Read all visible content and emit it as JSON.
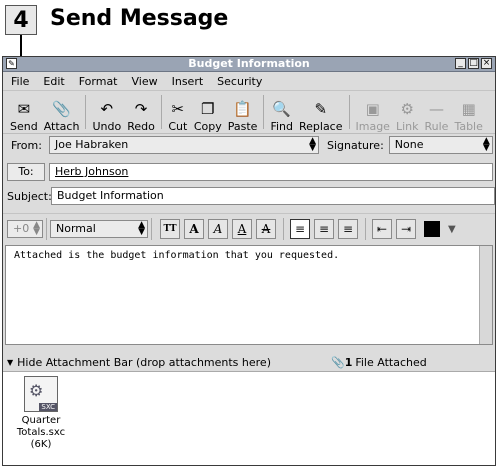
{
  "step": {
    "number": "4",
    "title": "Send Message"
  },
  "window": {
    "title": "Budget Information"
  },
  "menu": [
    {
      "label": "File"
    },
    {
      "label": "Edit"
    },
    {
      "label": "Format"
    },
    {
      "label": "View"
    },
    {
      "label": "Insert"
    },
    {
      "label": "Security"
    }
  ],
  "toolbar": [
    {
      "label": "Send",
      "icon": "send-icon",
      "glyph": "✉",
      "enabled": true
    },
    {
      "label": "Attach",
      "icon": "attach-icon",
      "glyph": "📎",
      "enabled": true
    },
    {
      "sep": true
    },
    {
      "label": "Undo",
      "icon": "undo-icon",
      "glyph": "↶",
      "enabled": true
    },
    {
      "label": "Redo",
      "icon": "redo-icon",
      "glyph": "↷",
      "enabled": true
    },
    {
      "sep": true
    },
    {
      "label": "Cut",
      "icon": "cut-icon",
      "glyph": "✂",
      "enabled": true
    },
    {
      "label": "Copy",
      "icon": "copy-icon",
      "glyph": "❐",
      "enabled": true
    },
    {
      "label": "Paste",
      "icon": "paste-icon",
      "glyph": "📋",
      "enabled": true
    },
    {
      "sep": true
    },
    {
      "label": "Find",
      "icon": "find-icon",
      "glyph": "🔍",
      "enabled": true
    },
    {
      "label": "Replace",
      "icon": "replace-icon",
      "glyph": "✎",
      "enabled": true
    },
    {
      "sep": true
    },
    {
      "label": "Image",
      "icon": "image-icon",
      "glyph": "▣",
      "enabled": false
    },
    {
      "label": "Link",
      "icon": "link-icon",
      "glyph": "⚙",
      "enabled": false
    },
    {
      "label": "Rule",
      "icon": "rule-icon",
      "glyph": "—",
      "enabled": false
    },
    {
      "label": "Table",
      "icon": "table-icon",
      "glyph": "▦",
      "enabled": false
    }
  ],
  "from": {
    "label": "From:",
    "value": "Joe Habraken"
  },
  "signature": {
    "label": "Signature:",
    "value": "None"
  },
  "to": {
    "label": "To:",
    "value": "Herb Johnson"
  },
  "subject": {
    "label": "Subject:",
    "value": "Budget Information"
  },
  "format": {
    "size": "+0",
    "style": "Normal"
  },
  "message": {
    "body": "Attached is the budget information that you requested."
  },
  "attachments": {
    "toggle_label": "Hide Attachment Bar (drop attachments here)",
    "count_label": "File Attached",
    "count": "1",
    "items": [
      {
        "name": "Quarter Totals.sxc (6K)",
        "badge": "SXC"
      }
    ]
  }
}
